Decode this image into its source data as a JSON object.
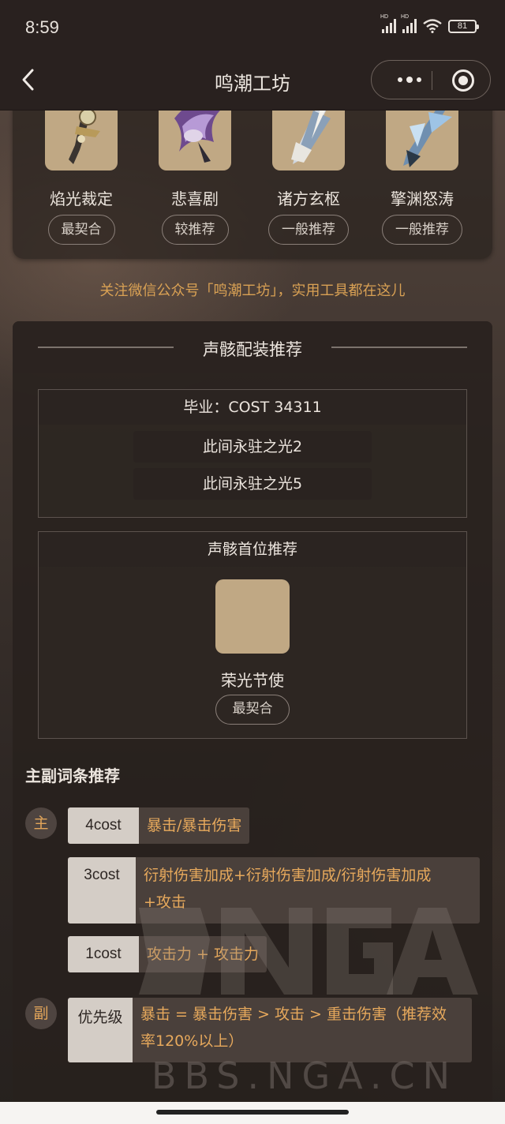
{
  "status_bar": {
    "time": "8:59",
    "battery": "81"
  },
  "nav": {
    "title": "鸣潮工坊"
  },
  "weapons": [
    {
      "name": "焰光裁定",
      "tag": "最契合"
    },
    {
      "name": "悲喜剧",
      "tag": "较推荐"
    },
    {
      "name": "诸方玄枢",
      "tag": "一般推荐"
    },
    {
      "name": "擎渊怒涛",
      "tag": "一般推荐"
    }
  ],
  "promo": "关注微信公众号「鸣潮工坊」，实用工具都在这儿",
  "echo_section": {
    "title": "声骸配装推荐",
    "graduation": {
      "title": "毕业：COST 34311",
      "items": [
        "此间永驻之光2",
        "此间永驻之光5"
      ]
    },
    "first_slot": {
      "title": "声骸首位推荐",
      "name": "荣光节使",
      "tag": "最契合"
    }
  },
  "stats": {
    "title": "主副词条推荐",
    "main_badge": "主",
    "sub_badge": "副",
    "main": [
      {
        "cost": "4cost",
        "value": "暴击/暴击伤害"
      },
      {
        "cost": "3cost",
        "value_line1": "衍射伤害加成+衍射伤害加成/衍射伤害加成",
        "value_line2": "+攻击"
      },
      {
        "cost": "1cost",
        "value": "攻击力 + 攻击力"
      }
    ],
    "sub": {
      "label": "优先级",
      "value_line1": "暴击 = 暴击伤害 > 攻击 > 重击伤害（推荐效",
      "value_line2": "率120%以上）"
    }
  },
  "watermark": {
    "logo": "NGA",
    "url": "BBS.NGA.CN"
  }
}
